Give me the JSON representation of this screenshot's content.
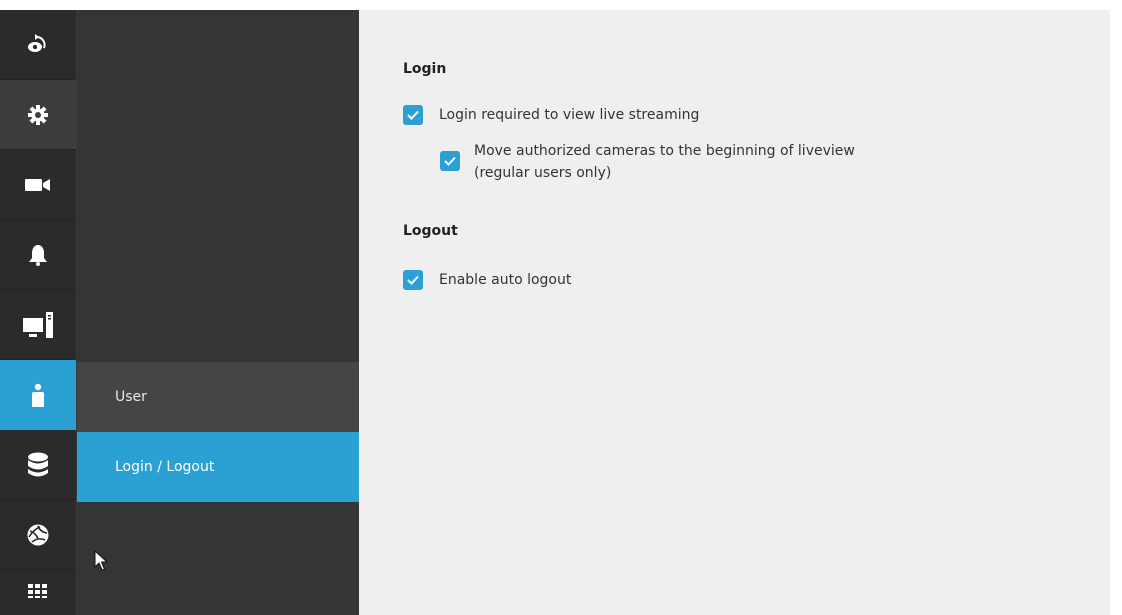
{
  "rail": {
    "items": [
      {
        "icon": "live-view-icon"
      },
      {
        "icon": "gear-icon"
      },
      {
        "icon": "camera-icon"
      },
      {
        "icon": "bell-icon"
      },
      {
        "icon": "computer-icon"
      },
      {
        "icon": "user-icon",
        "active": true
      },
      {
        "icon": "database-icon"
      },
      {
        "icon": "network-globe-icon"
      },
      {
        "icon": "apps-grid-icon"
      }
    ]
  },
  "submenu": {
    "items": [
      {
        "label": "User"
      },
      {
        "label": "Login / Logout",
        "selected": true
      }
    ]
  },
  "content": {
    "login": {
      "title": "Login",
      "login_required": {
        "label": "Login required to view live streaming",
        "checked": true
      },
      "move_cameras": {
        "label_line1": "Move authorized cameras to the beginning of liveview",
        "label_line2": "(regular users only)",
        "checked": true
      }
    },
    "logout": {
      "title": "Logout",
      "auto_logout": {
        "label": "Enable auto logout",
        "checked": true
      }
    }
  },
  "colors": {
    "accent": "#2aa0d4",
    "rail_bg": "#2b2b2b",
    "submenu_bg": "#353535",
    "content_bg": "#efefef"
  }
}
